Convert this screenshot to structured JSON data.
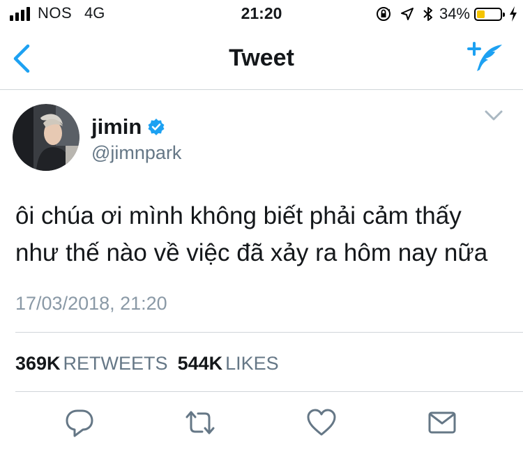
{
  "status_bar": {
    "carrier": "NOS",
    "network": "4G",
    "time": "21:20",
    "battery_percent": "34%",
    "battery_level": 0.34,
    "battery_color": "#f5c400",
    "icons": [
      "signal-bars-icon",
      "orientation-lock-icon",
      "location-arrow-icon",
      "bluetooth-icon",
      "battery-icon",
      "charging-bolt-icon"
    ]
  },
  "nav": {
    "title": "Tweet",
    "back_icon": "chevron-left-icon",
    "compose_icon": "compose-tweet-icon",
    "accent_color": "#1da1f2"
  },
  "tweet": {
    "display_name": "jimin",
    "verified": true,
    "handle": "@jimnpark",
    "text_line1": "ôi chúa ơi mình không biết phải cảm thấy",
    "text_line2": "như thế nào về việc đã xảy ra hôm nay nữa",
    "timestamp": "17/03/2018, 21:20",
    "retweets_count": "369K",
    "retweets_label": "RETWEETS",
    "likes_count": "544K",
    "likes_label": "LIKES"
  },
  "actions": [
    "reply-icon",
    "retweet-icon",
    "like-icon",
    "direct-message-icon"
  ]
}
